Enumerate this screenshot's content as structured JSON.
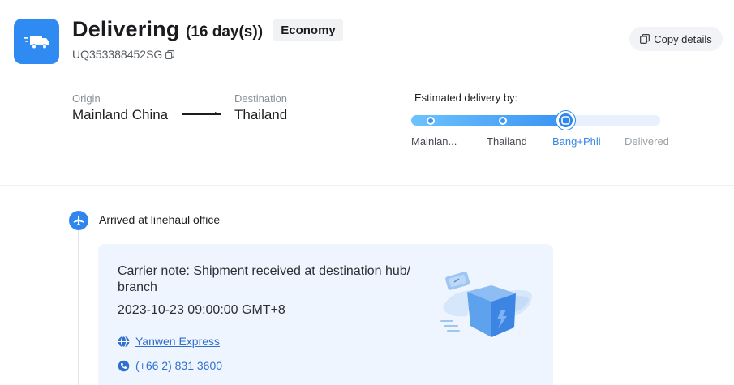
{
  "header": {
    "status": "Delivering",
    "days": "(16 day(s))",
    "service": "Economy",
    "tracking_number": "UQ353388452SG",
    "copy_details_label": "Copy details",
    "icons": {
      "status": "truck-icon",
      "copy": "copy-icon"
    }
  },
  "route": {
    "origin_label": "Origin",
    "origin": "Mainland China",
    "destination_label": "Destination",
    "destination": "Thailand"
  },
  "progress": {
    "eta_label": "Estimated delivery by:",
    "steps": [
      "Mainlan...",
      "Thailand",
      "Bang+Phli",
      "Delivered"
    ],
    "current_step_index": 2,
    "fill_fraction": 0.62
  },
  "timeline": {
    "event": {
      "title": "Arrived at linehaul office",
      "note": "Carrier note: Shipment received at destination hub/ branch",
      "time": "2023-10-23 09:00:00 GMT+8",
      "carrier": "Yanwen Express",
      "phone": "(+66 2) 831 3600",
      "icons": {
        "event": "airplane-icon",
        "carrier": "globe-icon",
        "phone": "phone-icon"
      }
    }
  },
  "colors": {
    "accent": "#2f86ec",
    "accent_light": "#6cc3ff",
    "card_bg": "#eff5fe",
    "link": "#2f6fcf",
    "muted": "#8a8f96"
  }
}
